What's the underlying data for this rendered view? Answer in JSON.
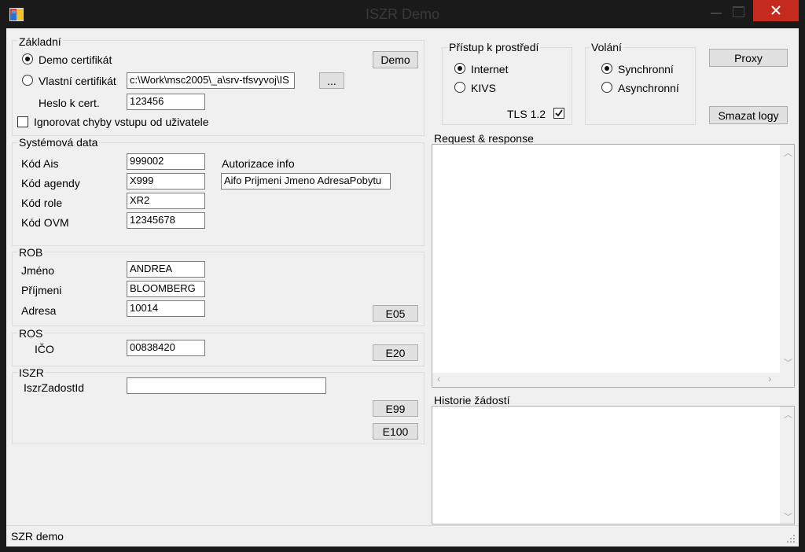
{
  "window": {
    "title": "ISZR Demo"
  },
  "zakladni": {
    "legend": "Základní",
    "demo_cert_label": "Demo certifikát",
    "own_cert_label": "Vlastní certifikát",
    "cert_path": "c:\\Work\\msc2005\\_a\\srv-tfsvyvoj\\IS",
    "browse_label": "...",
    "password_label": "Heslo k cert.",
    "password_value": "123456",
    "ignore_label": "Ignorovat chyby vstupu od uživatele",
    "demo_button": "Demo"
  },
  "system": {
    "legend": "Systémová data",
    "kod_ais_label": "Kód Ais",
    "kod_ais_value": "999002",
    "kod_agendy_label": "Kód agendy",
    "kod_agendy_value": "X999",
    "kod_role_label": "Kód role",
    "kod_role_value": "XR2",
    "kod_ovm_label": "Kód OVM",
    "kod_ovm_value": "12345678",
    "autorizace_label": "Autorizace info",
    "autorizace_value": "Aifo Prijmeni Jmeno AdresaPobytu"
  },
  "rob": {
    "legend": "ROB",
    "jmeno_label": "Jméno",
    "jmeno_value": "ANDREA",
    "prijmeni_label": "Příjmeni",
    "prijmeni_value": "BLOOMBERG",
    "adresa_label": "Adresa",
    "adresa_value": "10014",
    "button": "E05"
  },
  "ros": {
    "legend": "ROS",
    "ico_label": "IČO",
    "ico_value": "00838420",
    "button": "E20"
  },
  "iszr": {
    "legend": "ISZR",
    "zadost_label": "IszrZadostId",
    "zadost_value": "",
    "e99": "E99",
    "e100": "E100"
  },
  "pristup": {
    "legend": "Přístup k prostředí",
    "internet": "Internet",
    "kivs": "KIVS",
    "tls": "TLS 1.2"
  },
  "volani": {
    "legend": "Volání",
    "sync": "Synchronní",
    "async": "Asynchronní"
  },
  "buttons": {
    "proxy": "Proxy",
    "clear_logs": "Smazat logy"
  },
  "request_label": "Request & response",
  "history_label": "Historie žádostí",
  "status": {
    "text": "SZR demo"
  },
  "colors": {
    "window_bg": "#1a1a1a",
    "close_red": "#c42b1c",
    "client_bg": "#f0f0f0"
  }
}
